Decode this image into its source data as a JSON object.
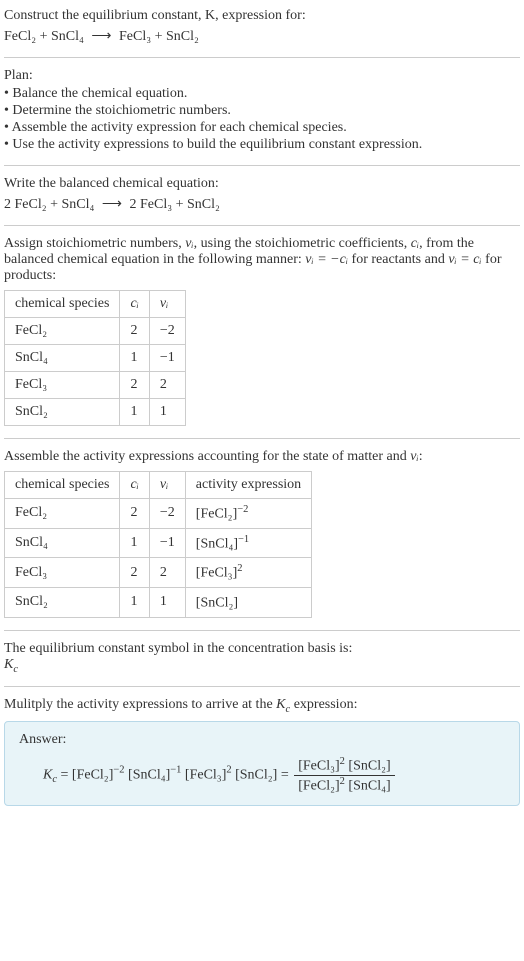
{
  "header": {
    "prompt": "Construct the equilibrium constant, K, expression for:",
    "equation_reactants": "FeCl₂ + SnCl₄",
    "equation_arrow": "⟶",
    "equation_products": "FeCl₃ + SnCl₂"
  },
  "plan": {
    "title": "Plan:",
    "items": [
      "Balance the chemical equation.",
      "Determine the stoichiometric numbers.",
      "Assemble the activity expression for each chemical species.",
      "Use the activity expressions to build the equilibrium constant expression."
    ]
  },
  "balanced": {
    "intro": "Write the balanced chemical equation:",
    "equation_reactants": "2 FeCl₂ + SnCl₄",
    "equation_arrow": "⟶",
    "equation_products": "2 FeCl₃ + SnCl₂"
  },
  "stoich": {
    "intro_part1": "Assign stoichiometric numbers, ",
    "intro_nu": "νᵢ",
    "intro_part2": ", using the stoichiometric coefficients, ",
    "intro_ci": "cᵢ",
    "intro_part3": ", from the balanced chemical equation in the following manner: ",
    "intro_eq1": "νᵢ = −cᵢ",
    "intro_part4": " for reactants and ",
    "intro_eq2": "νᵢ = cᵢ",
    "intro_part5": " for products:",
    "table": {
      "headers": [
        "chemical species",
        "cᵢ",
        "νᵢ"
      ],
      "rows": [
        {
          "species": "FeCl₂",
          "c": "2",
          "nu": "−2"
        },
        {
          "species": "SnCl₄",
          "c": "1",
          "nu": "−1"
        },
        {
          "species": "FeCl₃",
          "c": "2",
          "nu": "2"
        },
        {
          "species": "SnCl₂",
          "c": "1",
          "nu": "1"
        }
      ]
    }
  },
  "activity": {
    "intro_part1": "Assemble the activity expressions accounting for the state of matter and ",
    "intro_nu": "νᵢ",
    "intro_part2": ":",
    "table": {
      "headers": [
        "chemical species",
        "cᵢ",
        "νᵢ",
        "activity expression"
      ],
      "rows": [
        {
          "species": "FeCl₂",
          "c": "2",
          "nu": "−2",
          "expr_base": "[FeCl₂]",
          "expr_sup": "−2"
        },
        {
          "species": "SnCl₄",
          "c": "1",
          "nu": "−1",
          "expr_base": "[SnCl₄]",
          "expr_sup": "−1"
        },
        {
          "species": "FeCl₃",
          "c": "2",
          "nu": "2",
          "expr_base": "[FeCl₃]",
          "expr_sup": "2"
        },
        {
          "species": "SnCl₂",
          "c": "1",
          "nu": "1",
          "expr_base": "[SnCl₂]",
          "expr_sup": ""
        }
      ]
    }
  },
  "symbol": {
    "intro": "The equilibrium constant symbol in the concentration basis is:",
    "value": "K_c"
  },
  "final": {
    "intro_part1": "Mulitply the activity expressions to arrive at the ",
    "intro_kc": "K_c",
    "intro_part2": " expression:",
    "answer_label": "Answer:",
    "lhs": "K_c",
    "eq": " = ",
    "t1_base": "[FeCl₂]",
    "t1_sup": "−2",
    "t2_base": "[SnCl₄]",
    "t2_sup": "−1",
    "t3_base": "[FeCl₃]",
    "t3_sup": "2",
    "t4_base": "[SnCl₂]",
    "eq2": " = ",
    "num1_base": "[FeCl₃]",
    "num1_sup": "2",
    "num2_base": "[SnCl₂]",
    "den1_base": "[FeCl₂]",
    "den1_sup": "2",
    "den2_base": "[SnCl₄]"
  }
}
